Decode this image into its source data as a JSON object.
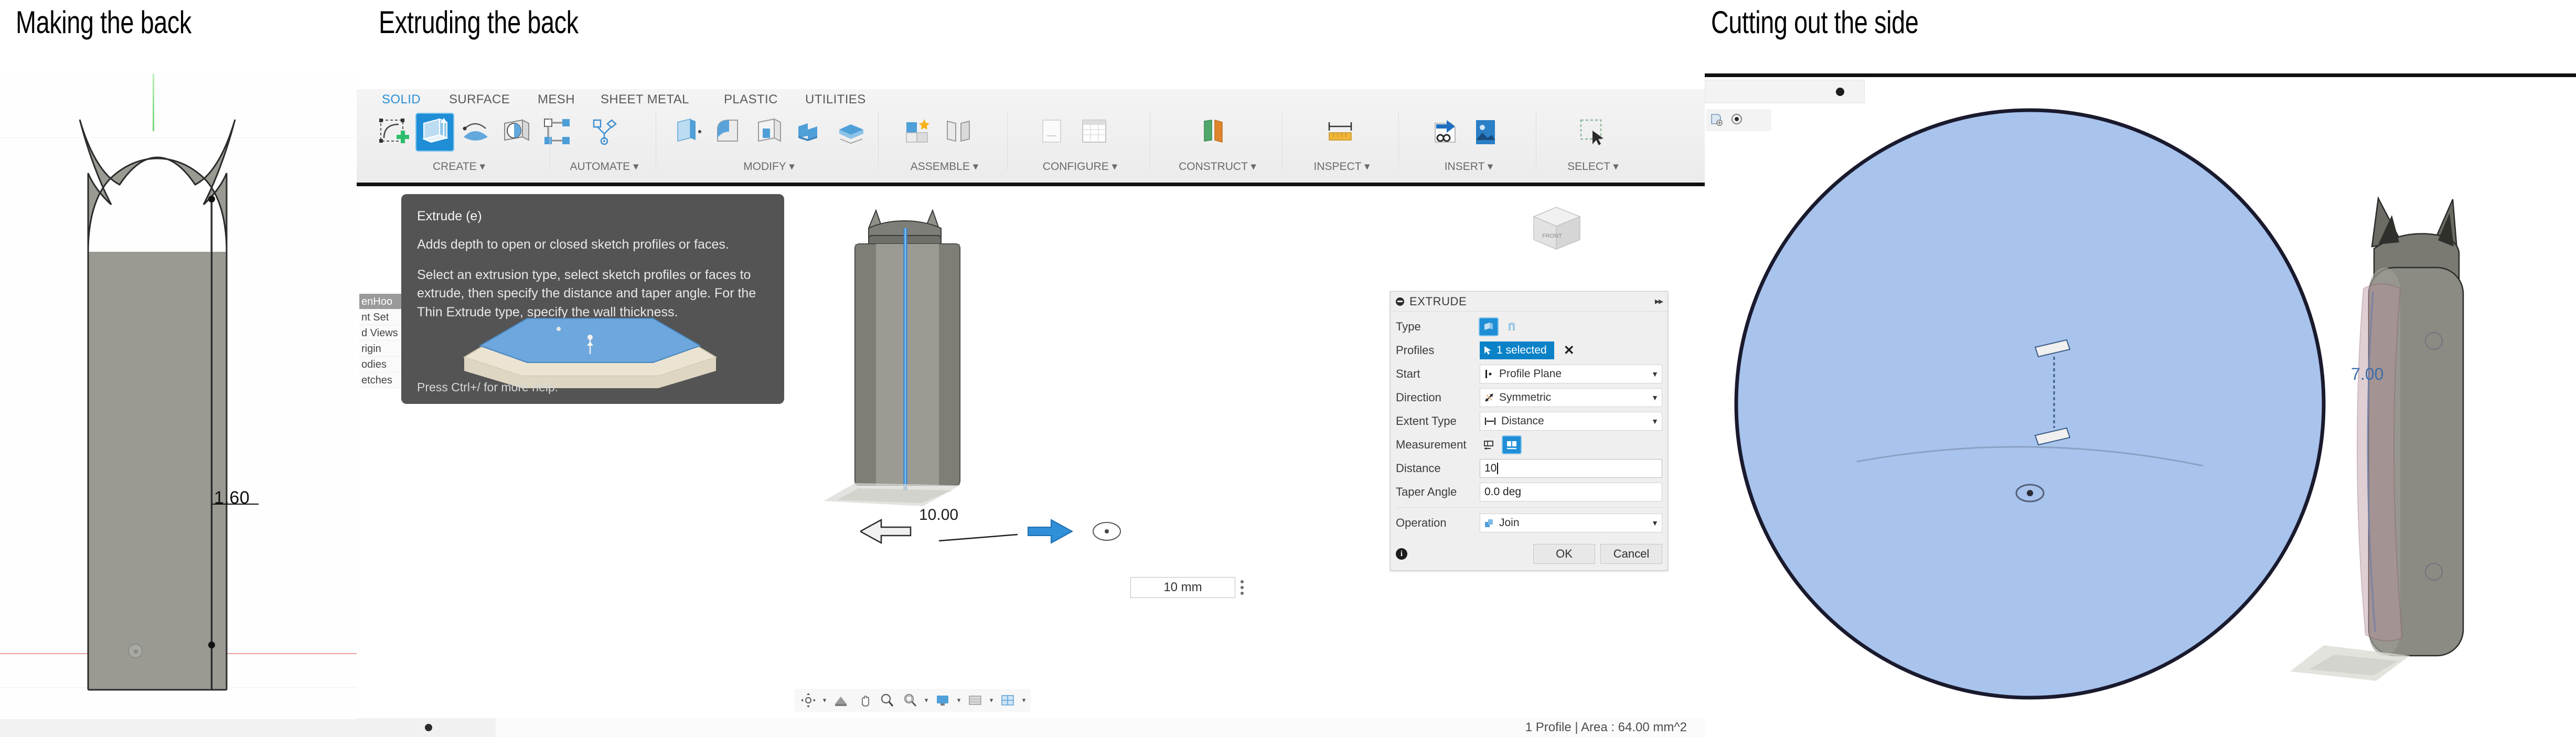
{
  "headings": [
    {
      "text": "Making the back"
    },
    {
      "text": "Extruding the back"
    },
    {
      "text": "Cutting out the side"
    }
  ],
  "panel1": {
    "name": "Making the back",
    "dimension_label": "1.60",
    "axis_color": "#72d472",
    "construction_color": "#e8a0a0",
    "body_fill": "#9a9a93"
  },
  "panel2": {
    "name": "Extruding the back",
    "ribbon": {
      "tabs": [
        {
          "label": "SOLID",
          "active": true
        },
        {
          "label": "SURFACE",
          "active": false
        },
        {
          "label": "MESH",
          "active": false
        },
        {
          "label": "SHEET METAL",
          "active": false
        },
        {
          "label": "PLASTIC",
          "active": false
        },
        {
          "label": "UTILITIES",
          "active": false
        }
      ],
      "groups": [
        {
          "label": "CREATE ▾"
        },
        {
          "label": "AUTOMATE ▾"
        },
        {
          "label": "MODIFY ▾"
        },
        {
          "label": "ASSEMBLE ▾"
        },
        {
          "label": "CONFIGURE ▾"
        },
        {
          "label": "CONSTRUCT ▾"
        },
        {
          "label": "INSPECT ▾"
        },
        {
          "label": "INSERT ▾"
        },
        {
          "label": "SELECT ▾"
        }
      ]
    },
    "tooltip": {
      "title": "Extrude (e)",
      "line1": "Adds depth to open or closed sketch profiles or faces.",
      "line2": "Select an extrusion type, select sketch profiles or faces to extrude, then specify the distance and taper angle. For the Thin Extrude type, specify the wall thickness.",
      "footer": "Press Ctrl+/ for more help."
    },
    "browser": [
      {
        "label": "enHoo"
      },
      {
        "label": "nt Set"
      },
      {
        "label": "d Views"
      },
      {
        "label": "rigin"
      },
      {
        "label": "odies"
      },
      {
        "label": "etches"
      }
    ],
    "viewport": {
      "extrude_dimension": "10.00",
      "manipulator_value": "10 mm"
    },
    "dialog": {
      "title": "EXTRUDE",
      "collapse_icon": "▸▸",
      "rows": {
        "type_label": "Type",
        "profiles_label": "Profiles",
        "profiles_value": "1 selected",
        "start_label": "Start",
        "start_value": "Profile Plane",
        "direction_label": "Direction",
        "direction_value": "Symmetric",
        "extent_label": "Extent Type",
        "extent_value": "Distance",
        "measurement_label": "Measurement",
        "distance_label": "Distance",
        "distance_value": "10",
        "taper_label": "Taper Angle",
        "taper_value": "0.0 deg",
        "operation_label": "Operation",
        "operation_value": "Join"
      },
      "ok_label": "OK",
      "cancel_label": "Cancel",
      "info_icon": "i"
    },
    "status_text": "1 Profile | Area : 64.00 mm^2",
    "nav_icons": [
      "orbit-icon",
      "look-at-icon",
      "pan-icon",
      "zoom-icon",
      "zoom-window-icon",
      "display-settings-icon",
      "grid-icon",
      "viewports-icon"
    ]
  },
  "panel3": {
    "name": "Cutting out the side",
    "circle_dimension": "7.00",
    "circle_fill": "#a8c3ec",
    "circle_stroke": "#1a1a2e"
  }
}
